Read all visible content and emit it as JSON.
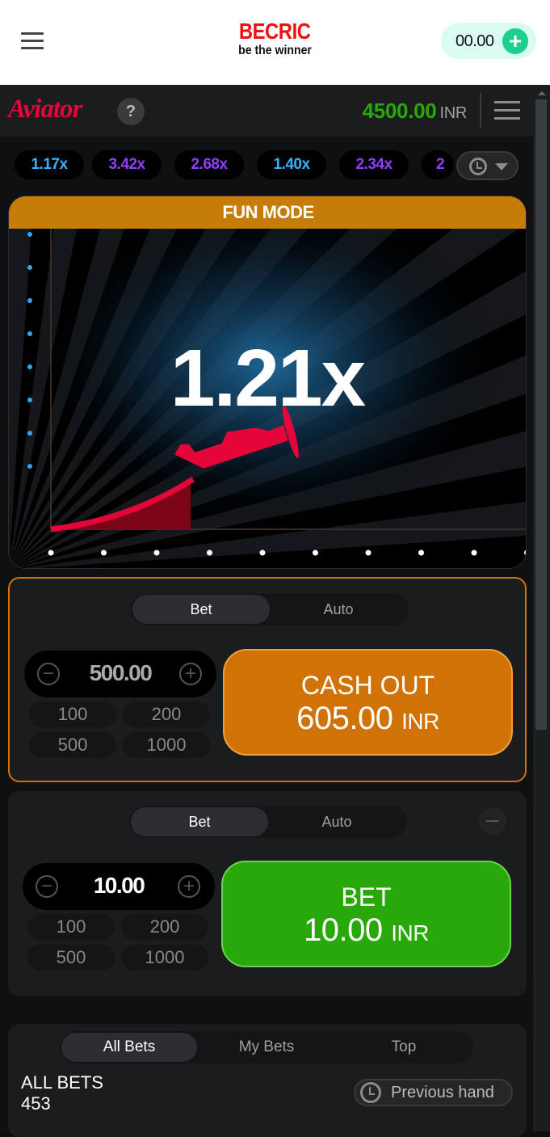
{
  "site": {
    "brand_name": "BECRIC",
    "brand_tagline": "be the winner",
    "wallet_amount": "00.00"
  },
  "game": {
    "title": "Aviator",
    "help_label": "?",
    "balance": "4500.00",
    "currency": "INR",
    "history": [
      {
        "value": "1.17x",
        "color": "#34b4ff"
      },
      {
        "value": "3.42x",
        "color": "#913ef8"
      },
      {
        "value": "2.68x",
        "color": "#913ef8"
      },
      {
        "value": "1.40x",
        "color": "#34b4ff"
      },
      {
        "value": "2.34x",
        "color": "#913ef8"
      },
      {
        "value": "2",
        "color": "#913ef8"
      }
    ],
    "mode_banner": "FUN MODE",
    "multiplier": "1.21x",
    "colors": {
      "accent_red": "#e50539",
      "fun_mode": "#c57c08",
      "cashout": "#d07206",
      "bet_green": "#28a909"
    }
  },
  "panels": [
    {
      "tabs": [
        "Bet",
        "Auto"
      ],
      "active_tab": "Bet",
      "amount": "500.00",
      "quick_amounts": [
        "100",
        "200",
        "500",
        "1000"
      ],
      "action_line1": "CASH OUT",
      "action_amount": "605.00",
      "action_currency": "INR",
      "state": "cashout"
    },
    {
      "tabs": [
        "Bet",
        "Auto"
      ],
      "active_tab": "Bet",
      "amount": "10.00",
      "quick_amounts": [
        "100",
        "200",
        "500",
        "1000"
      ],
      "action_line1": "BET",
      "action_amount": "10.00",
      "action_currency": "INR",
      "state": "bet"
    }
  ],
  "bets": {
    "tabs": [
      "All Bets",
      "My Bets",
      "Top"
    ],
    "active_tab": "All Bets",
    "heading": "ALL BETS",
    "count": "453",
    "previous_hand_label": "Previous hand"
  }
}
